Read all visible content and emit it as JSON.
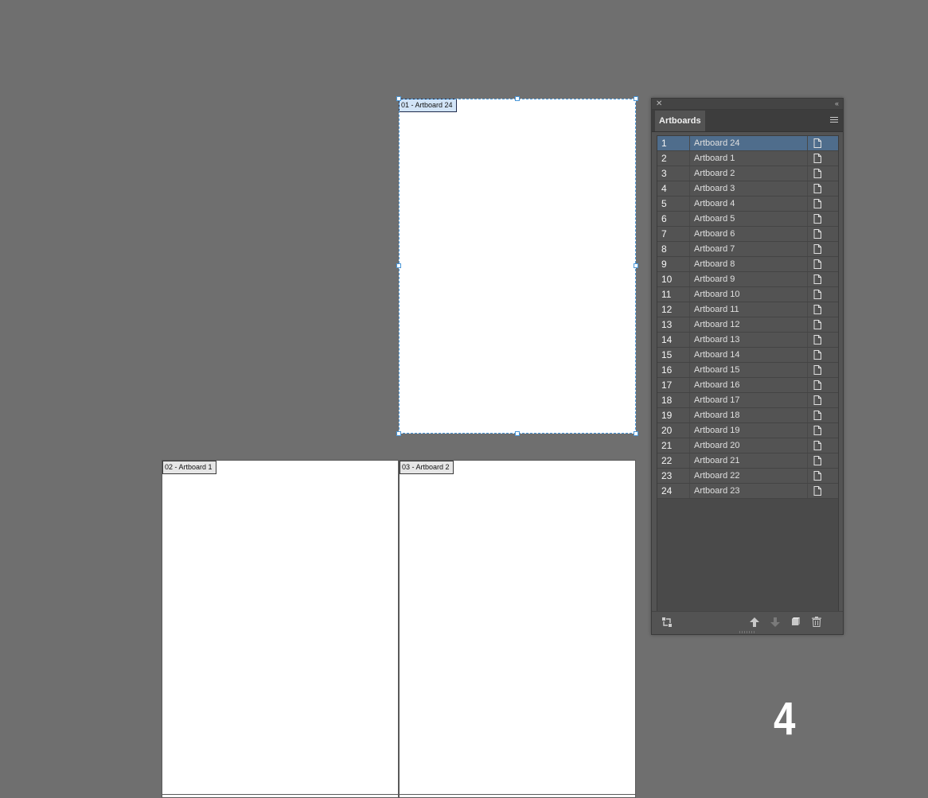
{
  "canvas": {
    "artboards": [
      {
        "label": "01 - Artboard 24",
        "selected": true
      },
      {
        "label": "02 - Artboard 1",
        "selected": false
      },
      {
        "label": "03 - Artboard 2",
        "selected": false
      }
    ]
  },
  "panel": {
    "tab_label": "Artboards",
    "close_icon": "close-icon",
    "collapse_icon": "double-chevron-left-icon",
    "menu_icon": "hamburger-menu-icon",
    "selected_color": "#4f6d8c",
    "rows": [
      {
        "num": "1",
        "name": "Artboard 24"
      },
      {
        "num": "2",
        "name": "Artboard 1"
      },
      {
        "num": "3",
        "name": "Artboard 2"
      },
      {
        "num": "4",
        "name": "Artboard 3"
      },
      {
        "num": "5",
        "name": "Artboard 4"
      },
      {
        "num": "6",
        "name": "Artboard 5"
      },
      {
        "num": "7",
        "name": "Artboard 6"
      },
      {
        "num": "8",
        "name": "Artboard 7"
      },
      {
        "num": "9",
        "name": "Artboard 8"
      },
      {
        "num": "10",
        "name": "Artboard 9"
      },
      {
        "num": "11",
        "name": "Artboard 10"
      },
      {
        "num": "12",
        "name": "Artboard 11"
      },
      {
        "num": "13",
        "name": "Artboard 12"
      },
      {
        "num": "14",
        "name": "Artboard 13"
      },
      {
        "num": "15",
        "name": "Artboard 14"
      },
      {
        "num": "16",
        "name": "Artboard 15"
      },
      {
        "num": "17",
        "name": "Artboard 16"
      },
      {
        "num": "18",
        "name": "Artboard 17"
      },
      {
        "num": "19",
        "name": "Artboard 18"
      },
      {
        "num": "20",
        "name": "Artboard 19"
      },
      {
        "num": "21",
        "name": "Artboard 20"
      },
      {
        "num": "22",
        "name": "Artboard 21"
      },
      {
        "num": "23",
        "name": "Artboard 22"
      },
      {
        "num": "24",
        "name": "Artboard 23"
      }
    ],
    "footer_icons": [
      "rearrange-artboards-icon",
      "move-up-icon",
      "move-down-icon",
      "new-artboard-icon",
      "trash-icon"
    ]
  },
  "overlay_number": "4"
}
